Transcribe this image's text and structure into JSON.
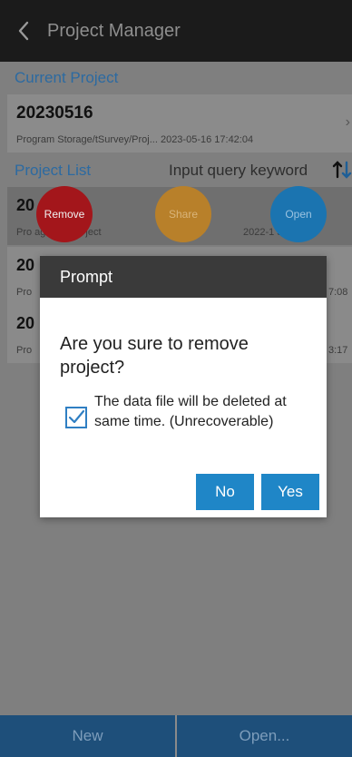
{
  "topbar": {
    "title": "Project Manager"
  },
  "current": {
    "section_label": "Current Project",
    "name": "20230516",
    "path": "Program Storage/tSurvey/Proj... 2023-05-16 17:42:04",
    "chevron": "›"
  },
  "list": {
    "section_label": "Project List",
    "search_label": "Input query keyword",
    "rows": [
      {
        "name": "20",
        "path": "Pro   age/tSurve       ject",
        "date": "2022-1     5:26"
      },
      {
        "name": "20",
        "path": "Pro",
        "date": "7:08"
      },
      {
        "name": "20",
        "path": "Pro",
        "date": "3:17"
      }
    ],
    "actions": {
      "remove": "Remove",
      "share": "Share",
      "open": "Open"
    }
  },
  "bottom": {
    "new_label": "New",
    "open_label": "Open..."
  },
  "dialog": {
    "title": "Prompt",
    "message": "Are you sure to remove project?",
    "checkbox_label": "The data file will be deleted at same time. (Unrecoverable)",
    "checkbox_checked": true,
    "no_label": "No",
    "yes_label": "Yes"
  },
  "colors": {
    "accent": "#1f86c7",
    "remove": "#a3161b",
    "share": "#b8802a",
    "open": "#1b74b0",
    "header_dark": "#3a3a3a"
  },
  "icons": [
    "back-arrow-icon",
    "sort-icon",
    "chevron-right-icon",
    "checkmark-icon"
  ]
}
